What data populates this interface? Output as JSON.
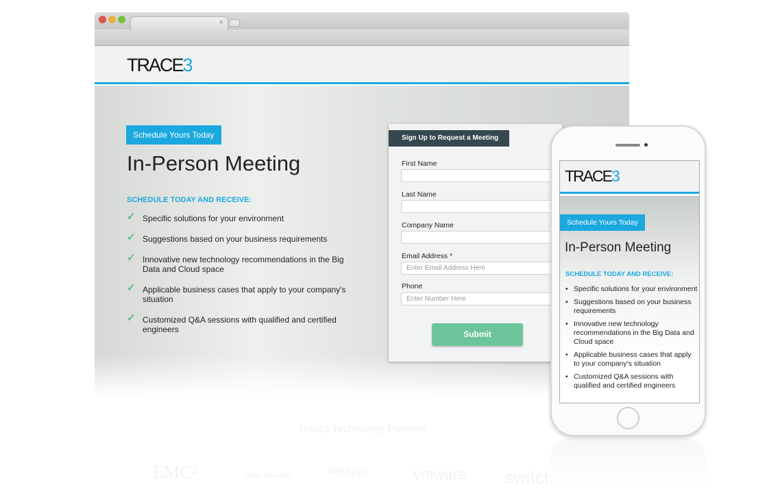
{
  "colors": {
    "accent": "#1ba8df",
    "form_header": "#37474f",
    "submit": "#6cc59a",
    "check": "#5fb88a"
  },
  "browser": {
    "tab_close": "×",
    "new_tab": "+"
  },
  "logo": {
    "text": "TRACE",
    "digit": "3"
  },
  "hero": {
    "badge": "Schedule Yours Today",
    "title": "In-Person Meeting",
    "subtitle": "SCHEDULE TODAY AND RECEIVE:",
    "benefits": [
      "Specific solutions for your environment",
      "Suggestions based on your business requirements",
      "Innovative new technology recommendations in the Big Data and Cloud space",
      "Applicable business cases that apply to your company's situation",
      "Customized Q&A sessions with qualified and certified engineers"
    ]
  },
  "form": {
    "title": "Sign Up to Request a Meeting",
    "fields": [
      {
        "label": "First Name",
        "value": "",
        "placeholder": ""
      },
      {
        "label": "Last Name",
        "value": "",
        "placeholder": ""
      },
      {
        "label": "Company Name",
        "value": "",
        "placeholder": ""
      },
      {
        "label": "Email Address *",
        "value": "",
        "placeholder": "Enter Email Address Here"
      },
      {
        "label": "Phone",
        "value": "",
        "placeholder": "Enter Number Here"
      }
    ],
    "submit": "Submit"
  },
  "partners": {
    "title": "Trace3 Technology Partners",
    "logos": [
      "EMC²",
      "Data Fountain",
      "NetApp",
      "vmware",
      "switch"
    ]
  },
  "phone": {
    "badge": "Schedule Yours Today",
    "title": "In-Person Meeting",
    "subtitle": "SCHEDULE TODAY AND RECEIVE:",
    "benefits": [
      "Specific solutions for your environment",
      "Suggestions based on your business requirements",
      "Innovative new technology recommendations in the Big Data and Cloud space",
      "Applicable business cases that apply to your company's situation",
      "Customized Q&A sessions with qualified and certified engineers"
    ]
  }
}
